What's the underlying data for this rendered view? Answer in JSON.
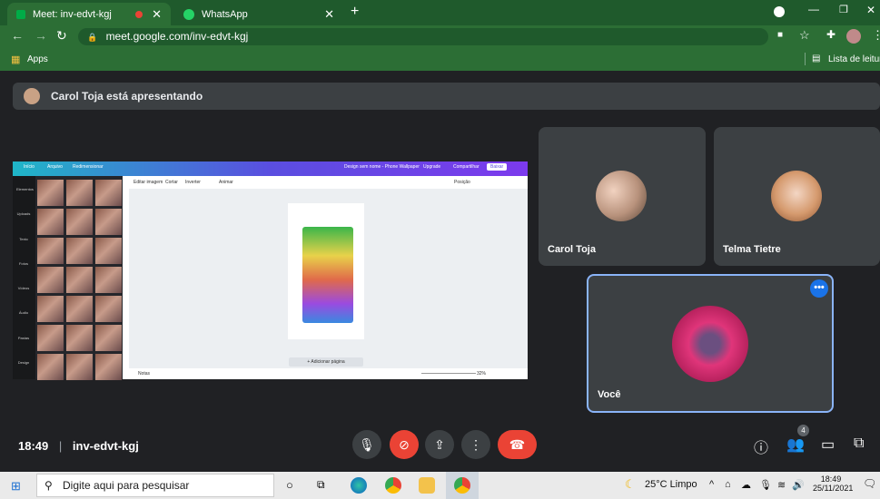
{
  "browser": {
    "tabs": [
      {
        "label": "Meet: inv-edvt-kgj",
        "icon": "meet-icon",
        "active": true
      },
      {
        "label": "WhatsApp",
        "icon": "whatsapp-icon",
        "active": false
      }
    ],
    "new_tab": "+",
    "url": "meet.google.com/inv-edvt-kgj",
    "bookmarks_apps": "Apps",
    "reading_list": "Lista de leitura"
  },
  "meet": {
    "presenting_text": "Carol Toja está apresentando",
    "canva": {
      "top_items": [
        "Início",
        "Arquivo",
        "Redimensionar",
        "Design sem nome - Phone Wallpaper",
        "Upgrade",
        "Compartilhar",
        "Baixar"
      ],
      "sub_items": [
        "Editar imagem",
        "Cortar",
        "Inverter",
        "Animar",
        "Posição"
      ],
      "side_items": [
        "Elementos",
        "Uploads",
        "Texto",
        "Fotos",
        "Vídeos",
        "Áudio",
        "Pastas",
        "Design"
      ],
      "add_page": "+ Adicionar página",
      "notes": "Notas",
      "zoom": "32%"
    },
    "participants": [
      {
        "name": "Carol Toja"
      },
      {
        "name": "Telma Tietre"
      },
      {
        "name": "Você"
      }
    ],
    "more_options": "•••",
    "time": "18:49",
    "meeting_code": "inv-edvt-kgj",
    "people_count": "4",
    "colors": {
      "accent": "#1a73e8",
      "danger": "#ea4335",
      "tile": "#3c4043",
      "bg": "#202124"
    }
  },
  "taskbar": {
    "search_placeholder": "Digite aqui para pesquisar",
    "weather": "25°C  Limpo",
    "time": "18:49",
    "date": "25/11/2021"
  }
}
